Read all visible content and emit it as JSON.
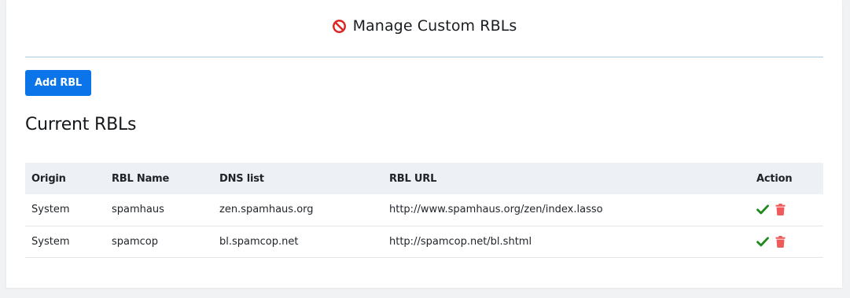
{
  "header": {
    "title": "Manage Custom RBLs",
    "icon": "ban-icon",
    "icon_color": "#e02424"
  },
  "toolbar": {
    "add_label": "Add RBL",
    "add_color": "#0a74e8"
  },
  "section": {
    "title": "Current RBLs"
  },
  "table": {
    "headers": [
      "Origin",
      "RBL Name",
      "DNS list",
      "RBL URL",
      "Action"
    ],
    "rows": [
      {
        "origin": "System",
        "name": "spamhaus",
        "dns": "zen.spamhaus.org",
        "url": "http://www.spamhaus.org/zen/index.lasso",
        "actions": [
          "check-icon",
          "trash-icon"
        ]
      },
      {
        "origin": "System",
        "name": "spamcop",
        "dns": "bl.spamcop.net",
        "url": "http://spamcop.net/bl.shtml",
        "actions": [
          "check-icon",
          "trash-icon"
        ]
      }
    ]
  },
  "colors": {
    "check": "#1e8a1e",
    "trash": "#ef5a5a",
    "header_row_bg": "#edf1f6",
    "divider": "#a9cbe0"
  }
}
